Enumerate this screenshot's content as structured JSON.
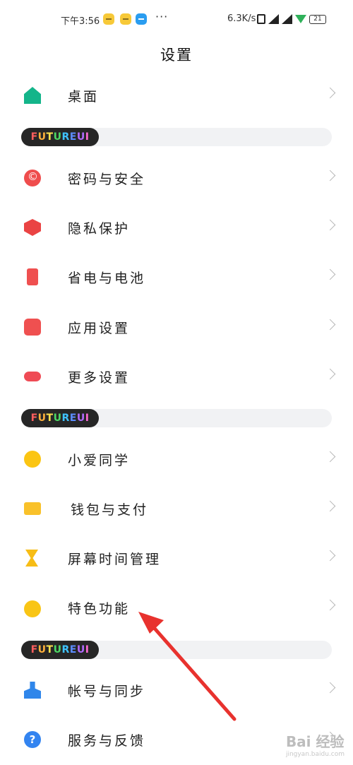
{
  "status_bar": {
    "time": "下午3:56",
    "more": "···",
    "net_speed": "6.3K/s",
    "battery": "21"
  },
  "page_title": "设置",
  "sections": [
    {
      "badge": "FUTURE UI",
      "items": [
        {
          "label": "桌面",
          "icon": "home-icon"
        }
      ]
    },
    {
      "badge": "FUTURE UI",
      "items": [
        {
          "label": "密码与安全",
          "icon": "lock-icon"
        },
        {
          "label": "隐私保护",
          "icon": "shield-icon"
        },
        {
          "label": "省电与电池",
          "icon": "battery-icon"
        },
        {
          "label": "应用设置",
          "icon": "android-icon"
        },
        {
          "label": "更多设置",
          "icon": "more-icon"
        }
      ]
    },
    {
      "badge": "FUTURE UI",
      "items": [
        {
          "label": "小爱同学",
          "icon": "chat-bubble-icon"
        },
        {
          "label": "钱包与支付",
          "icon": "wallet-icon"
        },
        {
          "label": "屏幕时间管理",
          "icon": "hourglass-icon"
        },
        {
          "label": "特色功能",
          "icon": "bulb-icon"
        }
      ]
    },
    {
      "badge": "FUTURE UI",
      "items": [
        {
          "label": "帐号与同步",
          "icon": "account-icon"
        },
        {
          "label": "服务与反馈",
          "icon": "help-icon"
        }
      ]
    }
  ],
  "icon_glyphs": {
    "help": "?"
  },
  "watermark": {
    "brand": "Bai 经验",
    "url": "jingyan.baidu.com"
  },
  "colors": {
    "badge_bg": "#262626",
    "arrow": "#e8322e"
  }
}
